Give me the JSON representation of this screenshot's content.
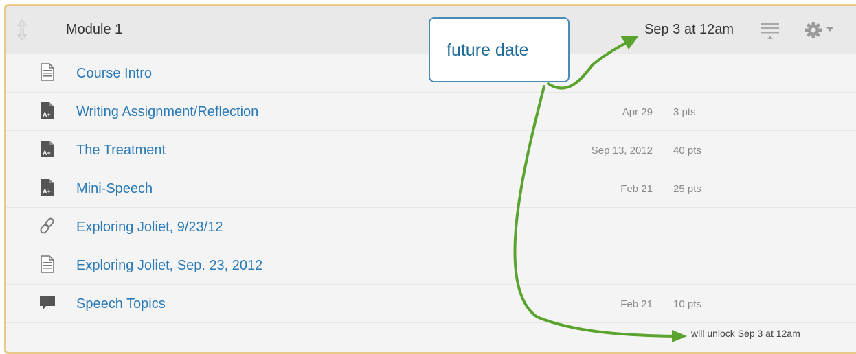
{
  "module": {
    "title": "Module 1",
    "lock_date": "Sep 3 at 12am"
  },
  "items": [
    {
      "title": "Course Intro",
      "icon": "page-icon",
      "due": "",
      "points": ""
    },
    {
      "title": "Writing Assignment/Reflection",
      "icon": "assignment-icon",
      "due": "Apr 29",
      "points": "3 pts"
    },
    {
      "title": "The Treatment",
      "icon": "assignment-icon",
      "due": "Sep 13, 2012",
      "points": "40 pts"
    },
    {
      "title": "Mini-Speech",
      "icon": "assignment-icon",
      "due": "Feb 21",
      "points": "25 pts"
    },
    {
      "title": "Exploring Joliet, 9/23/12",
      "icon": "link-icon",
      "due": "",
      "points": ""
    },
    {
      "title": "Exploring Joliet, Sep. 23, 2012",
      "icon": "page-icon",
      "due": "",
      "points": ""
    },
    {
      "title": "Speech Topics",
      "icon": "discussion-icon",
      "due": "Feb 21",
      "points": "10 pts"
    }
  ],
  "unlock_note": "will unlock Sep 3 at 12am",
  "callout": {
    "text": "future date"
  },
  "colors": {
    "link": "#2a7ab8",
    "frame_border": "#e8c987",
    "callout_border": "#4a8cb5",
    "arrow": "#5aa32e"
  }
}
